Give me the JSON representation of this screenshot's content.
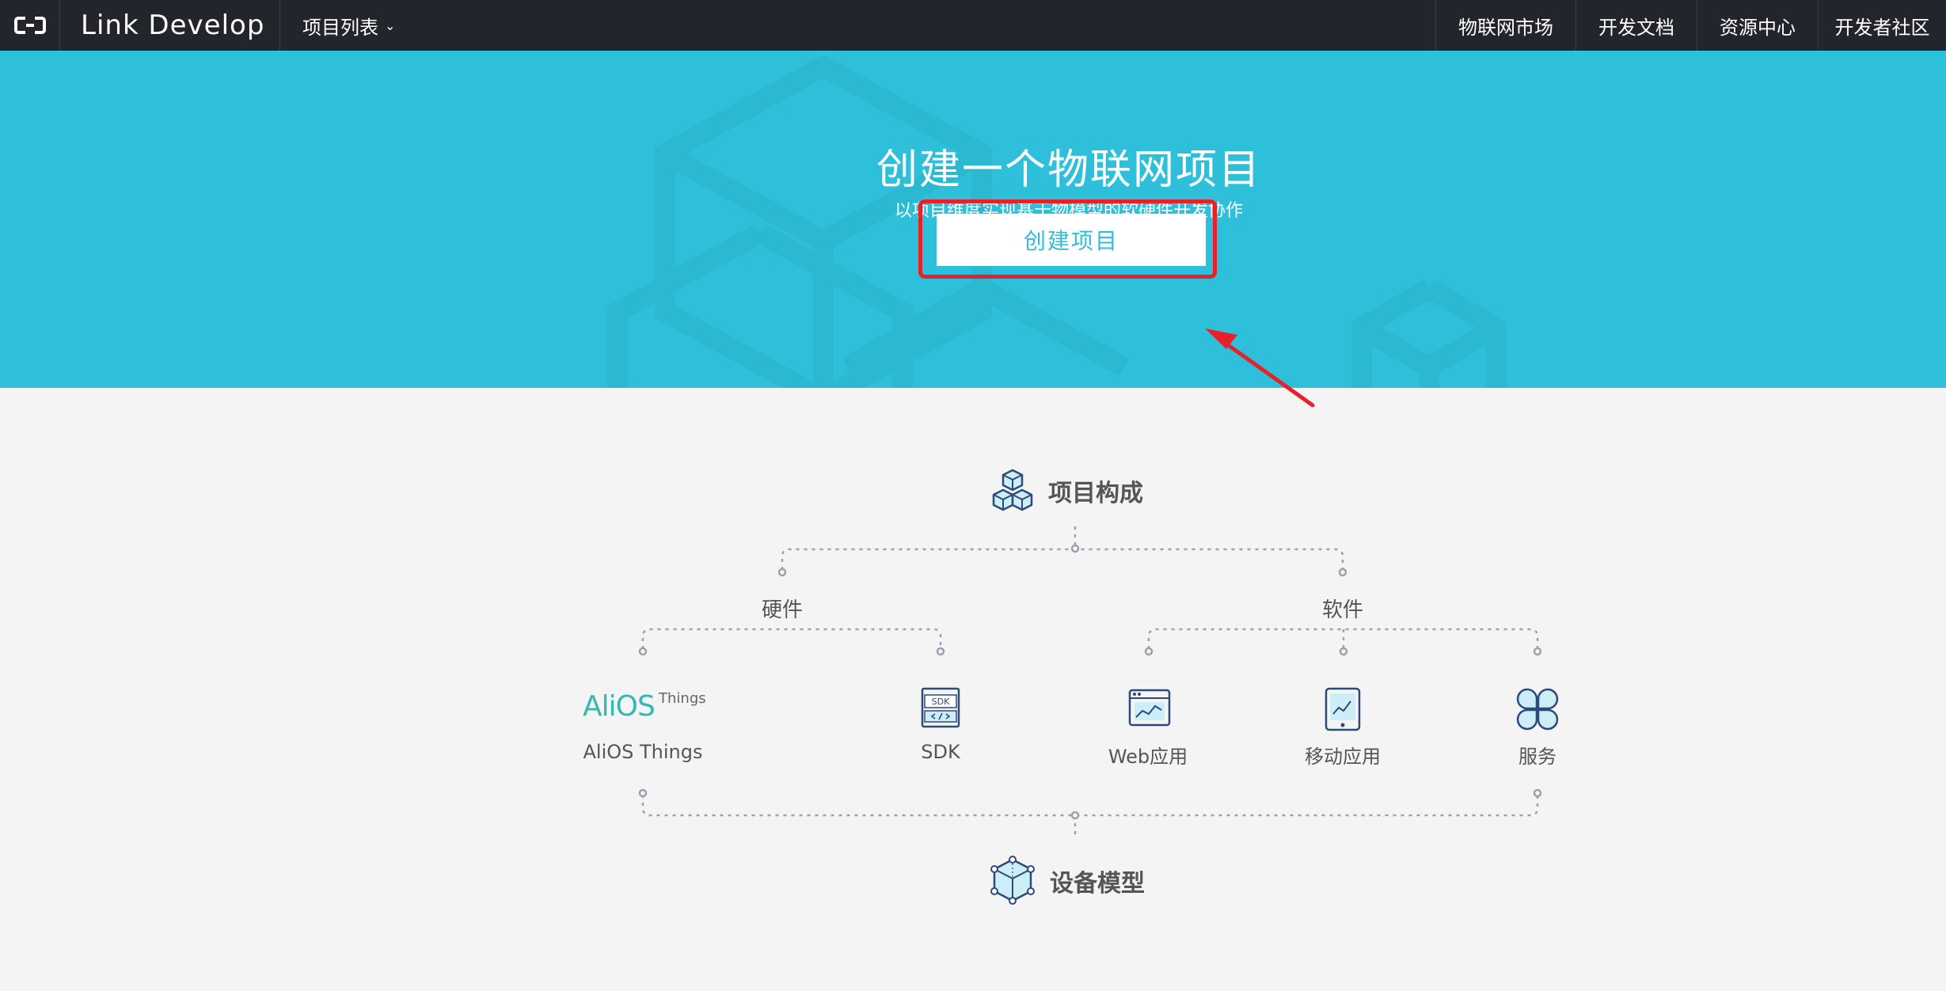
{
  "nav": {
    "brand": "Link Develop",
    "project_menu": "项目列表",
    "right_items": [
      "物联网市场",
      "开发文档",
      "资源中心",
      "开发者社区"
    ]
  },
  "hero": {
    "title": "创建一个物联网项目",
    "subtitle": "以项目维度实现基于物模型的软硬件开发协作",
    "create_button": "创建项目"
  },
  "composition": {
    "title": "项目构成",
    "hardware": "硬件",
    "software": "软件",
    "items": [
      "AliOS Things",
      "SDK",
      "Web应用",
      "移动应用",
      "服务"
    ],
    "aliox_logo_text": "AliOS",
    "aliox_logo_sup": "Things",
    "sdk_icon_text": "SDK",
    "bottom_title": "设备模型"
  },
  "colors": {
    "accent": "#2ec0da",
    "topbar": "#22252b",
    "highlight": "#e8202a",
    "icon_blue": "#2c4a7a"
  }
}
